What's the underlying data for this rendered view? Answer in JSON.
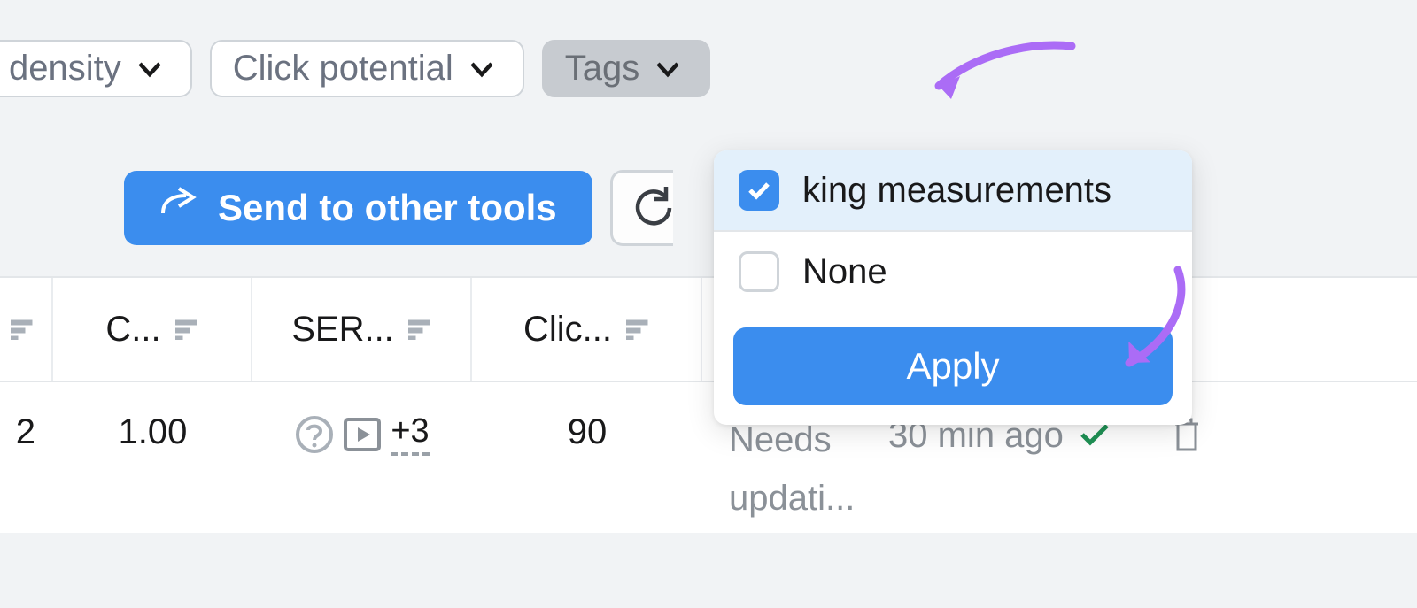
{
  "filters": {
    "density_label": "density",
    "click_potential_label": "Click potential",
    "tags_label": "Tags"
  },
  "toolbar": {
    "send_label": "Send to other tools"
  },
  "columns": {
    "c_label": "C...",
    "serp_label": "SER...",
    "click_label": "Clic..."
  },
  "row": {
    "leading": "2",
    "c_value": "1.00",
    "serp_more": "+3",
    "click_value": "90",
    "needs_line1": "Needs",
    "needs_line2": "updati...",
    "time_ago": "30 min ago"
  },
  "dropdown": {
    "items": [
      {
        "label": "king measurements",
        "checked": true
      },
      {
        "label": "None",
        "checked": false
      }
    ],
    "apply_label": "Apply"
  }
}
